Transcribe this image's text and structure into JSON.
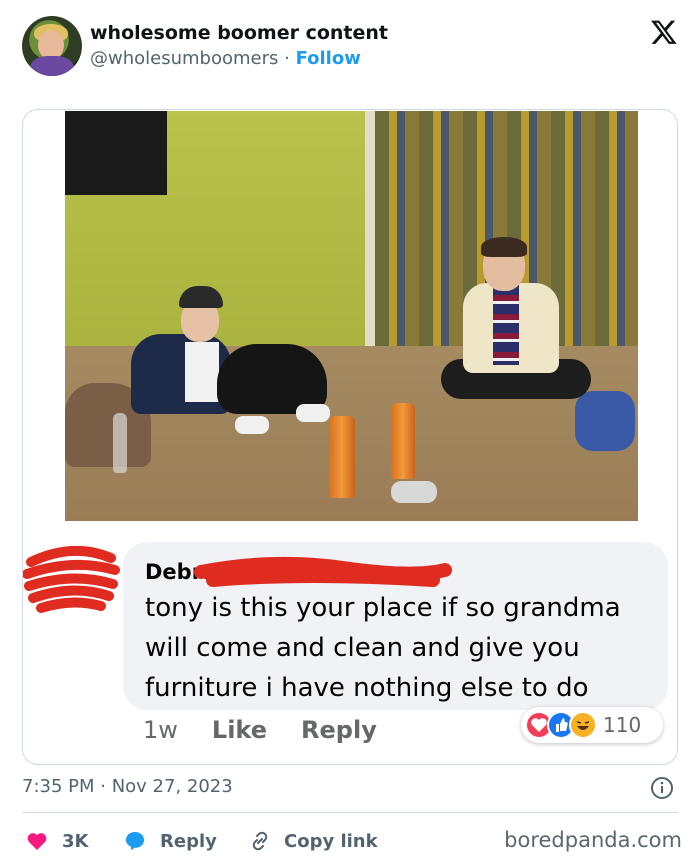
{
  "author": {
    "display_name": "wholesome boomer content",
    "handle": "@wholesumboomers",
    "separator": " · ",
    "follow_label": "Follow"
  },
  "header": {
    "logo_icon": "x-logo-icon"
  },
  "comment": {
    "name_visible": "Debra",
    "text": "tony is this your place if so grandma will come and clean and give you furniture i have nothing else to do",
    "time": "1w",
    "like_label": "Like",
    "reply_label": "Reply",
    "reaction_count": "110",
    "reaction_icons": [
      "love-reaction-icon",
      "like-reaction-icon",
      "haha-reaction-icon"
    ],
    "redaction_color": "#e02b20"
  },
  "timestamp": "7:35 PM · Nov 27, 2023",
  "footer": {
    "likes_count": "3K",
    "reply_label": "Reply",
    "copy_link_label": "Copy link",
    "watermark": "boredpanda.com"
  },
  "colors": {
    "follow": "#1d9bf0",
    "heart": "#f91880",
    "reply_bubble": "#1d9bf0",
    "secondary_text": "#536471"
  }
}
